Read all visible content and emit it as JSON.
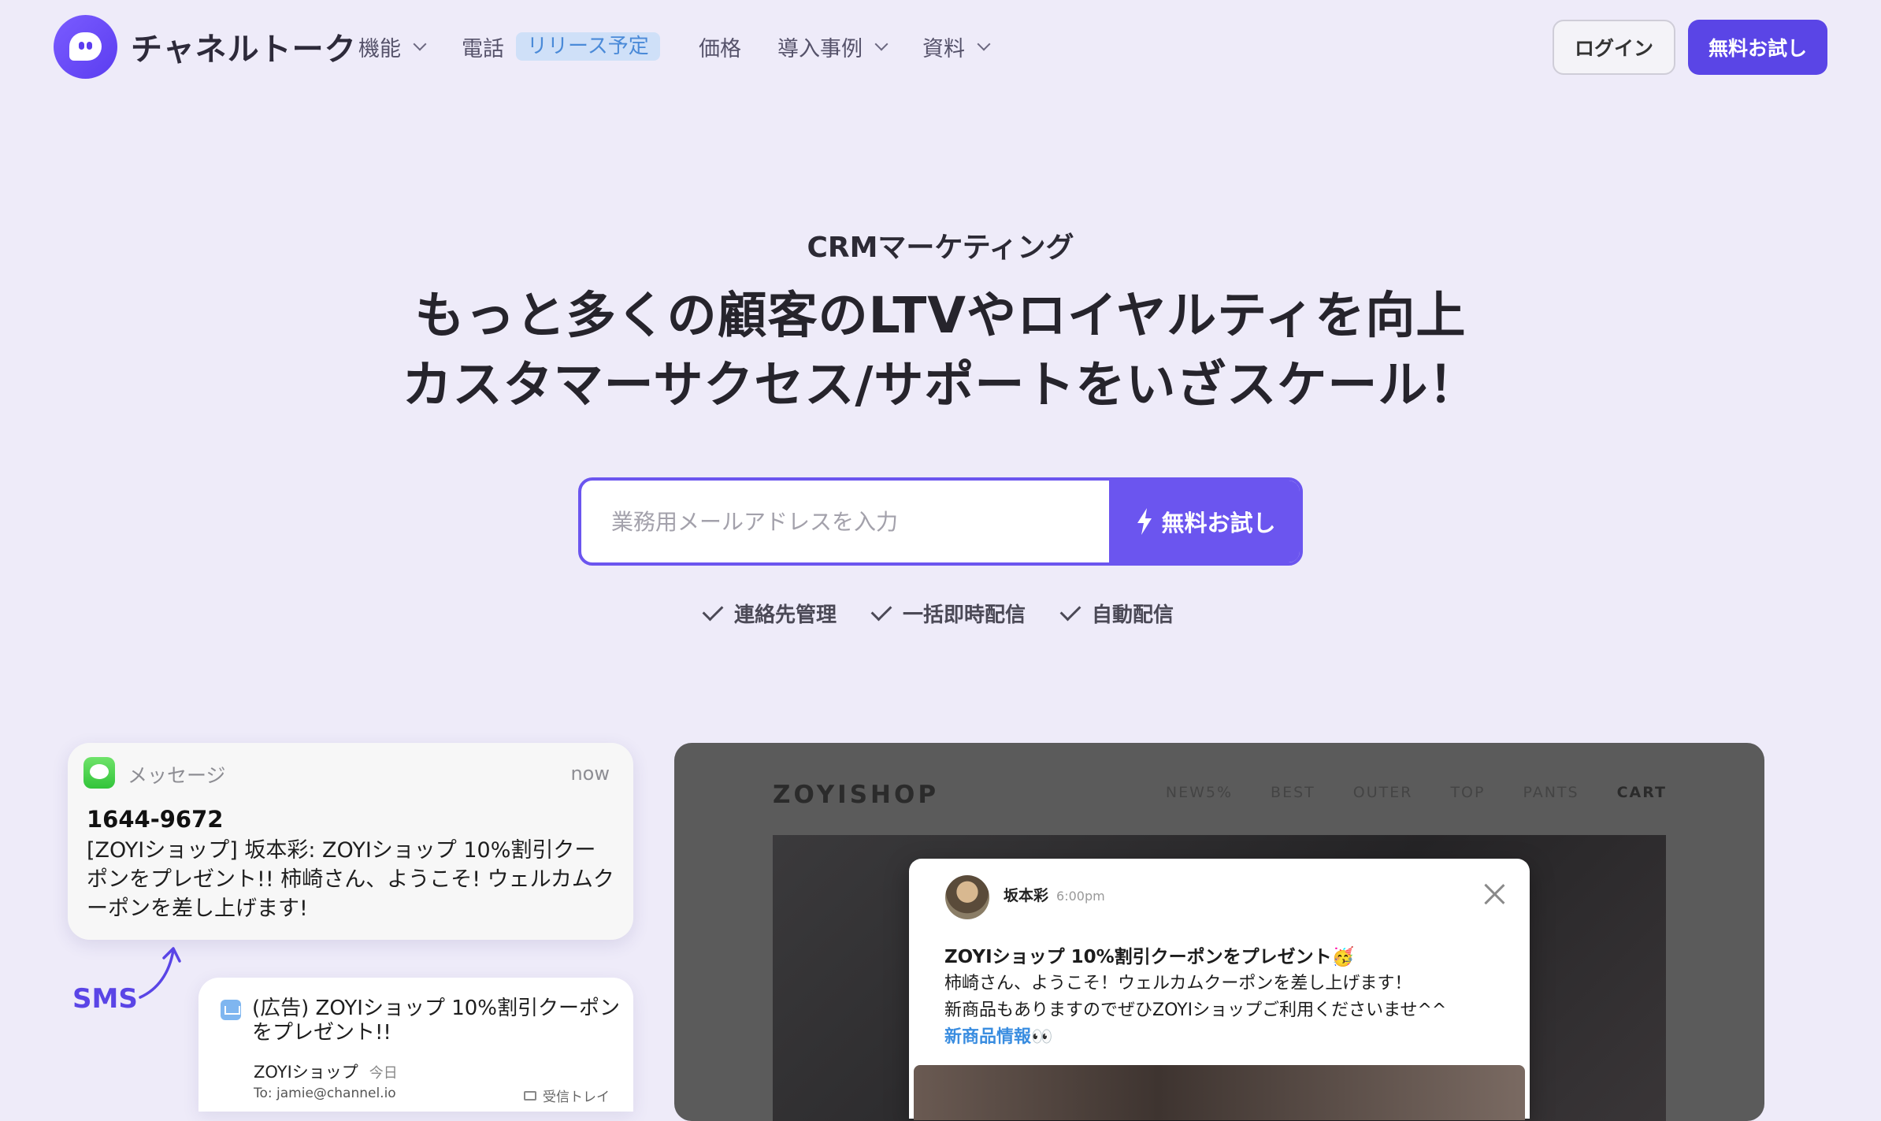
{
  "brand": {
    "name": "チャネルトーク"
  },
  "nav": {
    "items": [
      {
        "label": "機能",
        "dropdown": true
      },
      {
        "label": "電話",
        "dropdown": false
      },
      {
        "label": "価格",
        "dropdown": false
      },
      {
        "label": "導入事例",
        "dropdown": true
      },
      {
        "label": "資料",
        "dropdown": true
      }
    ],
    "release_badge": "リリース予定",
    "login": "ログイン",
    "trial": "無料お試し"
  },
  "hero": {
    "eyebrow": "CRMマーケティング",
    "headline_1": "もっと多くの顧客のLTVやロイヤルティを向上",
    "headline_2": "カスタマーサクセス/サポートをいざスケール！",
    "email_placeholder": "業務用メールアドレスを入力",
    "cta": "無料お試し",
    "features": [
      "連絡先管理",
      "一括即時配信",
      "自動配信"
    ]
  },
  "sms": {
    "app": "メッセージ",
    "time": "now",
    "from": "1644-9672",
    "body": "[ZOYIショップ] 坂本彩: ZOYIショップ 10%割引クーポンをプレゼント!! 柿崎さん、ようこそ! ウェルカムクーポンを差し上げます!",
    "label": "SMS"
  },
  "email": {
    "subject": "(広告) ZOYIショップ 10%割引クーポンをプレゼント!!",
    "sender": "ZOYIショップ",
    "date": "今日",
    "to": "To: jamie@channel.io",
    "folder": "受信トレイ"
  },
  "shop": {
    "logo": "ZOYISHOP",
    "nav": [
      "NEW5%",
      "BEST",
      "OUTER",
      "TOP",
      "PANTS",
      "CART"
    ]
  },
  "popup": {
    "name": "坂本彩",
    "time": "6:00pm",
    "title": "ZOYIショップ 10%割引クーポンをプレゼント🥳",
    "line1": "柿崎さん、ようこそ！ウェルカムクーポンを差し上げます！",
    "line2": "新商品もありますのでぜひZOYIショップご利用くださいませ^^",
    "link": "新商品情報👀"
  },
  "colors": {
    "accent": "#5a45e6",
    "background": "#eeebf9",
    "badge_bg": "#cfe0f8",
    "link": "#3a8de0"
  }
}
